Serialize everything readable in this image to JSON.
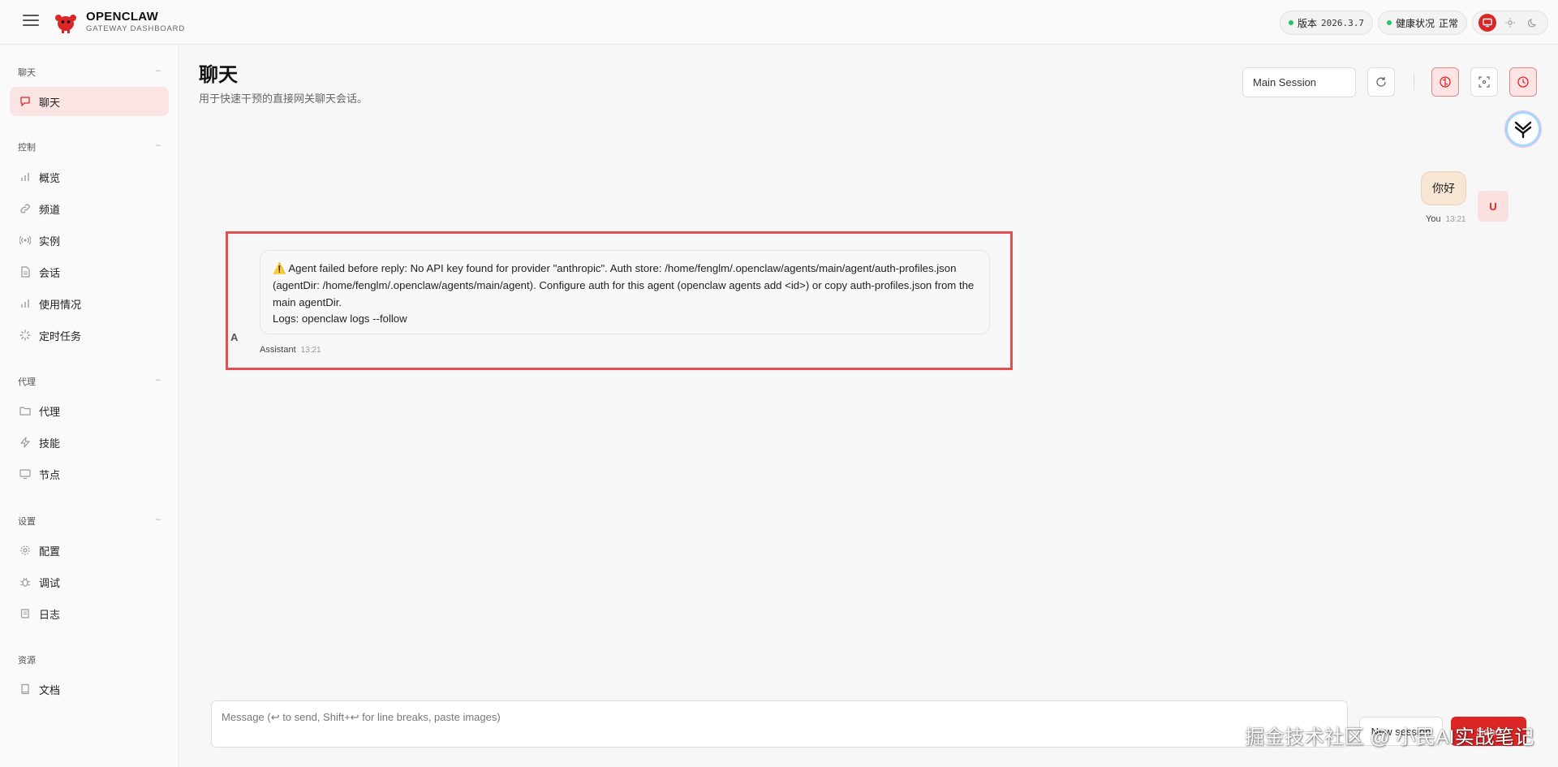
{
  "app": {
    "brand_name": "OPENCLAW",
    "brand_sub": "GATEWAY DASHBOARD"
  },
  "status": {
    "version_label": "版本",
    "version_value": "2026.3.7",
    "health_label": "健康状况",
    "health_value": "正常"
  },
  "sidebar": {
    "groups": [
      {
        "title": "聊天",
        "items": [
          {
            "label": "聊天",
            "icon": "message-icon",
            "active": true
          }
        ]
      },
      {
        "title": "控制",
        "items": [
          {
            "label": "概览",
            "icon": "bar-chart-icon"
          },
          {
            "label": "频道",
            "icon": "link-icon"
          },
          {
            "label": "实例",
            "icon": "radio-icon"
          },
          {
            "label": "会话",
            "icon": "document-icon"
          },
          {
            "label": "使用情况",
            "icon": "bar-chart-icon"
          },
          {
            "label": "定时任务",
            "icon": "loader-icon"
          }
        ]
      },
      {
        "title": "代理",
        "items": [
          {
            "label": "代理",
            "icon": "folder-icon"
          },
          {
            "label": "技能",
            "icon": "zap-icon"
          },
          {
            "label": "节点",
            "icon": "monitor-icon"
          }
        ]
      },
      {
        "title": "设置",
        "items": [
          {
            "label": "配置",
            "icon": "gear-icon"
          },
          {
            "label": "调试",
            "icon": "bug-icon"
          },
          {
            "label": "日志",
            "icon": "scroll-icon"
          }
        ]
      },
      {
        "title": "资源",
        "items": [
          {
            "label": "文档",
            "icon": "book-icon"
          }
        ]
      }
    ]
  },
  "main": {
    "title": "聊天",
    "subtitle": "用于快速干预的直接网关聊天会话。",
    "session_select": "Main Session"
  },
  "chat": {
    "user_message": "你好",
    "user_name": "You",
    "user_time": "13:21",
    "user_avatar": "U",
    "assistant_avatar": "A",
    "assistant_line1": "⚠️ Agent failed before reply: No API key found for provider \"anthropic\". Auth store: /home/fenglm/.openclaw/agents/main/agent/auth-profiles.json (agentDir: /home/fenglm/.openclaw/agents/main/agent). Configure auth for this agent (openclaw agents add <id>) or copy auth-profiles.json from the main agentDir.",
    "assistant_line2": "Logs: openclaw logs --follow",
    "assistant_name": "Assistant",
    "assistant_time": "13:21"
  },
  "composer": {
    "placeholder": "Message (↩ to send, Shift+↩ for line breaks, paste images)",
    "new_session_label": "New session",
    "send_label": "Send"
  },
  "watermark": "掘金技术社区 @ 小民AI实战笔记",
  "colors": {
    "accent": "#dc2626",
    "active_bg": "#fbe4e4",
    "highlight_border": "#e0504f",
    "status_ok": "#22c55e"
  }
}
